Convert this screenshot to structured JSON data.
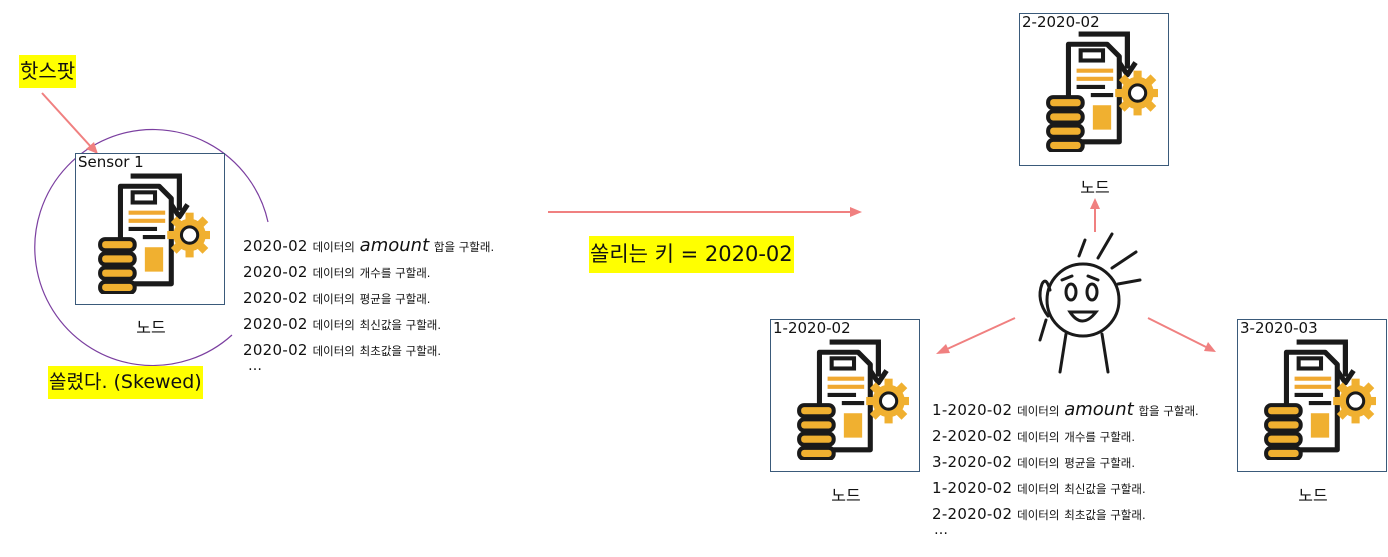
{
  "hotspot_label": "핫스팟",
  "skewed_label": "쏠렸다. (Skewed)",
  "skew_key_label": "쏠리는 키 = 2020-02",
  "node_caption": "노드",
  "colors": {
    "highlight": "#ffff00",
    "arrow": "#f08080",
    "circle": "#7b3fa0",
    "border": "#3a5a7a",
    "icon_orange": "#f0b030",
    "icon_dark": "#1a1a1a"
  },
  "left": {
    "box_label": "Sensor 1",
    "queries": [
      {
        "key": "2020-02",
        "pre": "데이터의",
        "mid": "amount",
        "post": "합을 구할래."
      },
      {
        "key": "2020-02",
        "pre": "데이터의",
        "mid": "",
        "post": "개수를 구할래."
      },
      {
        "key": "2020-02",
        "pre": "데이터의",
        "mid": "",
        "post": "평균을 구할래."
      },
      {
        "key": "2020-02",
        "pre": "데이터의",
        "mid": "",
        "post": "최신값을 구할래."
      },
      {
        "key": "2020-02",
        "pre": "데이터의",
        "mid": "",
        "post": "최초값을 구할래."
      }
    ],
    "ellipsis": "…"
  },
  "right": {
    "top_box_label": "2-2020-02",
    "left_box_label": "1-2020-02",
    "right_box_label": "3-2020-03",
    "queries": [
      {
        "key": "1-2020-02",
        "pre": "데이터의",
        "mid": "amount",
        "post": "합을 구할래."
      },
      {
        "key": "2-2020-02",
        "pre": "데이터의",
        "mid": "",
        "post": "개수를 구할래."
      },
      {
        "key": "3-2020-02",
        "pre": "데이터의",
        "mid": "",
        "post": "평균을 구할래."
      },
      {
        "key": "1-2020-02",
        "pre": "데이터의",
        "mid": "",
        "post": "최신값을 구할래."
      },
      {
        "key": "2-2020-02",
        "pre": "데이터의",
        "mid": "",
        "post": "최초값을 구할래."
      }
    ],
    "ellipsis": "…"
  }
}
